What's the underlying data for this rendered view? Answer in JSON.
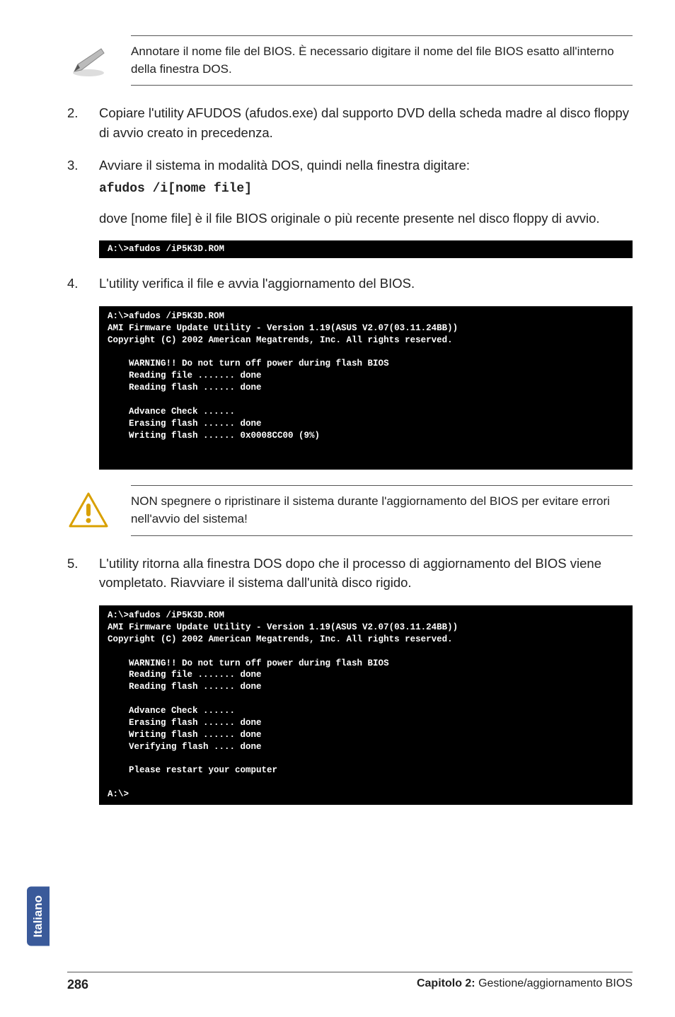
{
  "note1": "Annotare il nome file del BIOS. È necessario digitare il nome del file BIOS esatto all'interno della finestra DOS.",
  "steps": {
    "s2": {
      "num": "2.",
      "text": "Copiare l'utility AFUDOS (afudos.exe) dal supporto DVD della scheda madre al disco floppy di avvio creato in precedenza."
    },
    "s3": {
      "num": "3.",
      "text": "Avviare il sistema in modalità DOS, quindi nella finestra digitare:"
    },
    "s3code": "afudos /i[nome file]",
    "s3para": "dove [nome file] è il file BIOS originale o più recente presente nel disco floppy di avvio.",
    "s4": {
      "num": "4.",
      "text": "L'utility verifica il file e avvia l'aggiornamento del BIOS."
    },
    "s5": {
      "num": "5.",
      "text": "L'utility ritorna alla finestra DOS dopo che il processo di aggiornamento del BIOS viene vompletato. Riavviare il sistema dall'unità disco rigido."
    }
  },
  "term1": "A:\\>afudos /iP5K3D.ROM",
  "term2": "A:\\>afudos /iP5K3D.ROM\nAMI Firmware Update Utility - Version 1.19(ASUS V2.07(03.11.24BB))\nCopyright (C) 2002 American Megatrends, Inc. All rights reserved.\n\n    WARNING!! Do not turn off power during flash BIOS\n    Reading file ....... done\n    Reading flash ...... done\n\n    Advance Check ......\n    Erasing flash ...... done\n    Writing flash ...... 0x0008CC00 (9%)\n\n\n",
  "warn": "NON spegnere o ripristinare il sistema durante l'aggiornamento del BIOS per evitare errori nell'avvio del sistema!",
  "term3": "A:\\>afudos /iP5K3D.ROM\nAMI Firmware Update Utility - Version 1.19(ASUS V2.07(03.11.24BB))\nCopyright (C) 2002 American Megatrends, Inc. All rights reserved.\n\n    WARNING!! Do not turn off power during flash BIOS\n    Reading file ....... done\n    Reading flash ...... done\n\n    Advance Check ......\n    Erasing flash ...... done\n    Writing flash ...... done\n    Verifying flash .... done\n\n    Please restart your computer\n\nA:\\>",
  "sideTab": "Italiano",
  "footer": {
    "page": "286",
    "chapter": "Capitolo 2:",
    "title": " Gestione/aggiornamento BIOS"
  }
}
